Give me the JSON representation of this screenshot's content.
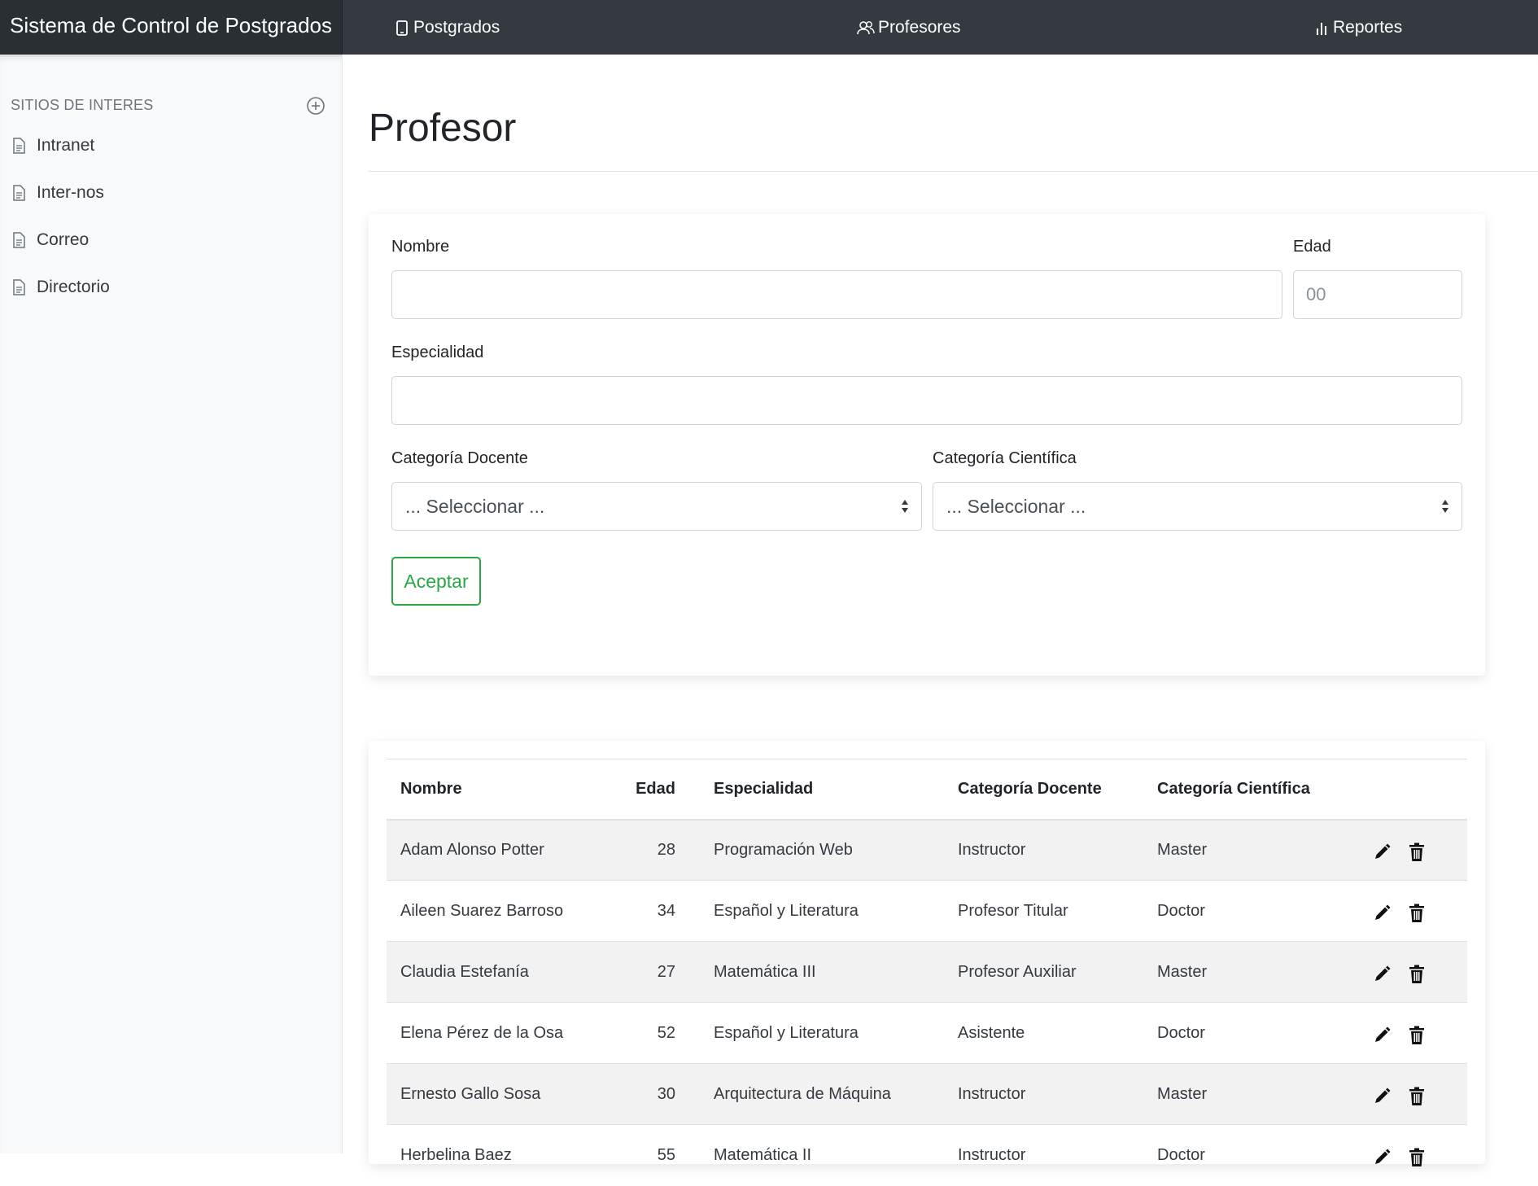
{
  "app": {
    "title": "Sistema de Control de Postgrados"
  },
  "nav": {
    "items": [
      {
        "label": "Postgrados",
        "icon": "tablet-icon"
      },
      {
        "label": "Profesores",
        "icon": "users-icon"
      },
      {
        "label": "Reportes",
        "icon": "bar-chart-icon"
      }
    ]
  },
  "sidebar": {
    "heading": "SITIOS DE INTERES",
    "add_icon": "plus-circle-icon",
    "items": [
      {
        "label": "Intranet",
        "icon": "file-text-icon"
      },
      {
        "label": "Inter-nos",
        "icon": "file-text-icon"
      },
      {
        "label": "Correo",
        "icon": "file-text-icon"
      },
      {
        "label": "Directorio",
        "icon": "file-text-icon"
      }
    ]
  },
  "page": {
    "title": "Profesor"
  },
  "form": {
    "nombre_label": "Nombre",
    "nombre_value": "",
    "edad_label": "Edad",
    "edad_placeholder": "00",
    "especialidad_label": "Especialidad",
    "especialidad_value": "",
    "cat_docente_label": "Categoría Docente",
    "cat_docente_selected": "... Seleccionar ...",
    "cat_cientifica_label": "Categoría Científica",
    "cat_cientifica_selected": "... Seleccionar ...",
    "accept_label": "Aceptar"
  },
  "table": {
    "headers": [
      "Nombre",
      "Edad",
      "Especialidad",
      "Categoría Docente",
      "Categoría Científica"
    ],
    "rows": [
      {
        "nombre": "Adam Alonso Potter",
        "edad": "28",
        "especialidad": "Programación Web",
        "docente": "Instructor",
        "cientifica": "Master"
      },
      {
        "nombre": "Aileen Suarez Barroso",
        "edad": "34",
        "especialidad": "Español y Literatura",
        "docente": "Profesor Titular",
        "cientifica": "Doctor"
      },
      {
        "nombre": "Claudia Estefanía",
        "edad": "27",
        "especialidad": "Matemática III",
        "docente": "Profesor Auxiliar",
        "cientifica": "Master"
      },
      {
        "nombre": "Elena Pérez de la Osa",
        "edad": "52",
        "especialidad": "Español y Literatura",
        "docente": "Asistente",
        "cientifica": "Doctor"
      },
      {
        "nombre": "Ernesto Gallo Sosa",
        "edad": "30",
        "especialidad": "Arquitectura de Máquina",
        "docente": "Instructor",
        "cientifica": "Master"
      },
      {
        "nombre": "Herbelina Baez",
        "edad": "55",
        "especialidad": "Matemática II",
        "docente": "Instructor",
        "cientifica": "Doctor"
      }
    ],
    "row_actions": [
      "pencil-icon",
      "trash-icon"
    ]
  },
  "colors": {
    "navbar": "#343a40",
    "brand_bg": "#2a2f34",
    "sidebar_bg": "#f8f9fa",
    "accept": "#28a745"
  }
}
